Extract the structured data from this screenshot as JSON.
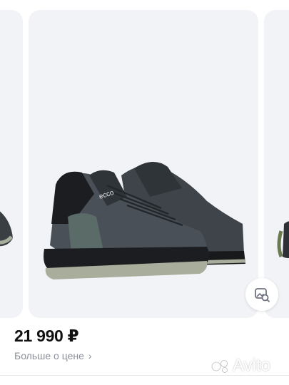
{
  "listing": {
    "price": "21 990 ₽",
    "price_details_link": "Больше о цене",
    "chevron": "›"
  },
  "gallery": {
    "images": [
      {
        "name": "previous-shoe-photo"
      },
      {
        "name": "ecco-sneakers-photo",
        "brand_text": "ecco"
      },
      {
        "name": "next-shoe-photo"
      }
    ],
    "image_search_icon": "image-search-icon"
  },
  "watermark": {
    "text": "Avito"
  },
  "colors": {
    "card_bg": "#f2f3f7",
    "price": "#111111",
    "link": "#8c8f99",
    "shoe_mesh": "#4a5057",
    "sole_dark": "#1c1d20",
    "sole_gray": "#a8ad9c"
  }
}
